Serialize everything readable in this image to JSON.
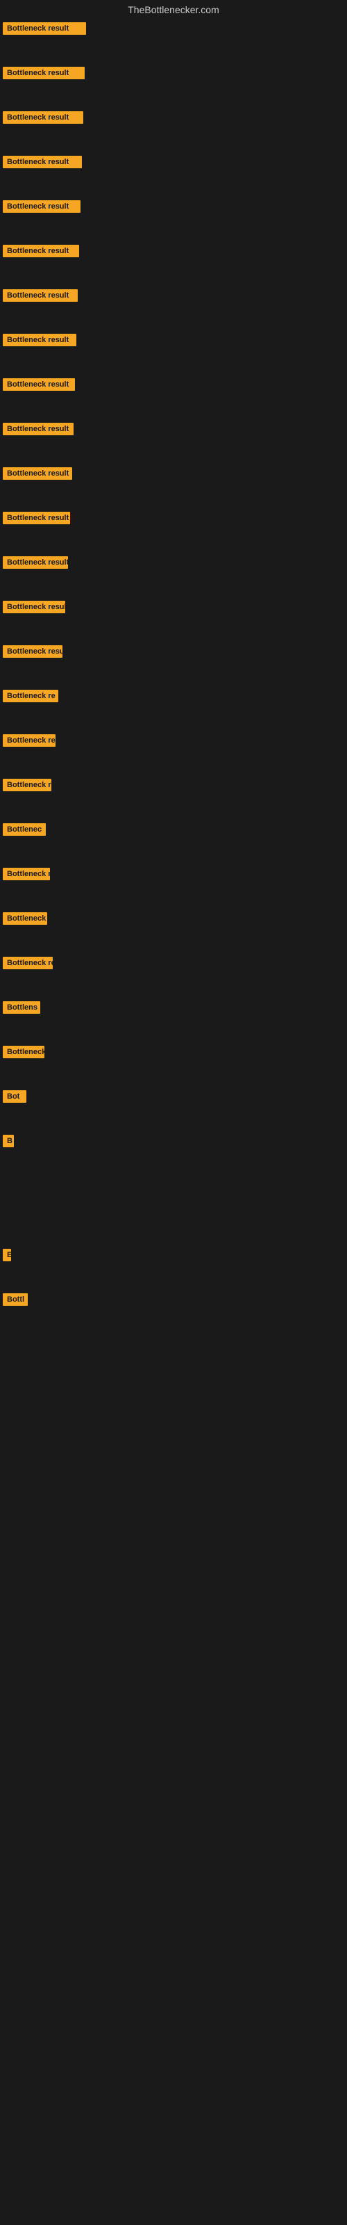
{
  "site": {
    "title": "TheBottlenecker.com"
  },
  "items": [
    {
      "label": "Bottleneck result",
      "width": 120,
      "margin_bottom": 35
    },
    {
      "label": "Bottleneck result",
      "width": 118,
      "margin_bottom": 35
    },
    {
      "label": "Bottleneck result",
      "width": 116,
      "margin_bottom": 35
    },
    {
      "label": "Bottleneck result",
      "width": 114,
      "margin_bottom": 35
    },
    {
      "label": "Bottleneck result",
      "width": 112,
      "margin_bottom": 35
    },
    {
      "label": "Bottleneck result",
      "width": 110,
      "margin_bottom": 35
    },
    {
      "label": "Bottleneck result",
      "width": 108,
      "margin_bottom": 35
    },
    {
      "label": "Bottleneck result",
      "width": 106,
      "margin_bottom": 35
    },
    {
      "label": "Bottleneck result",
      "width": 104,
      "margin_bottom": 35
    },
    {
      "label": "Bottleneck result",
      "width": 102,
      "margin_bottom": 35
    },
    {
      "label": "Bottleneck result",
      "width": 100,
      "margin_bottom": 35
    },
    {
      "label": "Bottleneck result",
      "width": 97,
      "margin_bottom": 35
    },
    {
      "label": "Bottleneck result",
      "width": 94,
      "margin_bottom": 35
    },
    {
      "label": "Bottleneck result",
      "width": 90,
      "margin_bottom": 35
    },
    {
      "label": "Bottleneck result",
      "width": 86,
      "margin_bottom": 35
    },
    {
      "label": "Bottleneck re",
      "width": 80,
      "margin_bottom": 35
    },
    {
      "label": "Bottleneck result",
      "width": 76,
      "margin_bottom": 35
    },
    {
      "label": "Bottleneck r",
      "width": 70,
      "margin_bottom": 35
    },
    {
      "label": "Bottlenec",
      "width": 62,
      "margin_bottom": 35
    },
    {
      "label": "Bottleneck r",
      "width": 68,
      "margin_bottom": 35
    },
    {
      "label": "Bottleneck",
      "width": 64,
      "margin_bottom": 35
    },
    {
      "label": "Bottleneck res",
      "width": 72,
      "margin_bottom": 35
    },
    {
      "label": "Bottlens",
      "width": 54,
      "margin_bottom": 35
    },
    {
      "label": "Bottleneck",
      "width": 60,
      "margin_bottom": 35
    },
    {
      "label": "Bot",
      "width": 34,
      "margin_bottom": 35
    },
    {
      "label": "B",
      "width": 16,
      "margin_bottom": 35
    },
    {
      "label": "",
      "width": 0,
      "margin_bottom": 80
    },
    {
      "label": "E",
      "width": 12,
      "margin_bottom": 35
    },
    {
      "label": "Bottl",
      "width": 36,
      "margin_bottom": 35
    }
  ]
}
